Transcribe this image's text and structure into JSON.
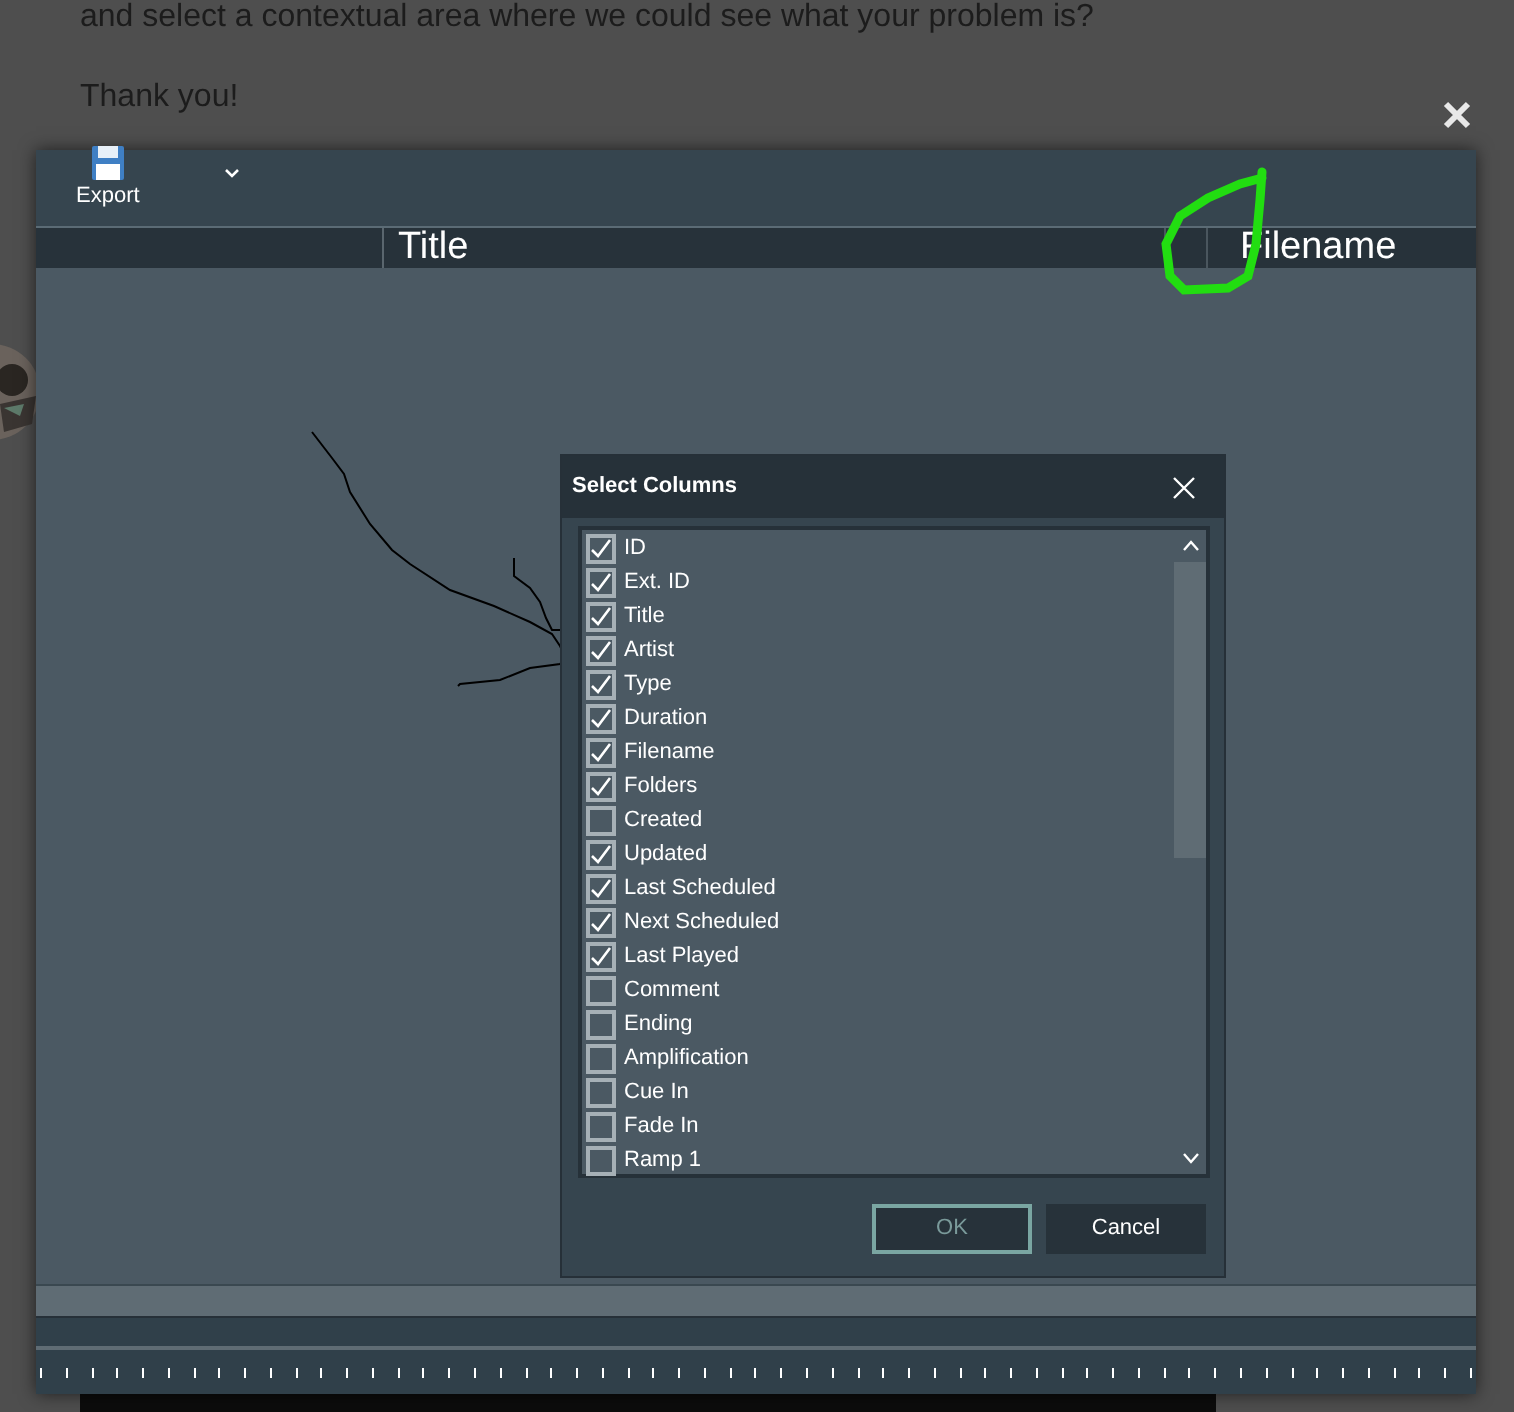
{
  "page": {
    "paragraphs": [
      "and select a contextual area where we could see what your problem is?",
      "Thank you!"
    ]
  },
  "toolbar": {
    "export_label": "Export"
  },
  "table": {
    "columns": [
      "Title",
      "Filename"
    ]
  },
  "dialog": {
    "title": "Select Columns",
    "items": [
      {
        "label": "ID",
        "checked": true
      },
      {
        "label": "Ext. ID",
        "checked": true
      },
      {
        "label": "Title",
        "checked": true
      },
      {
        "label": "Artist",
        "checked": true
      },
      {
        "label": "Type",
        "checked": true
      },
      {
        "label": "Duration",
        "checked": true
      },
      {
        "label": "Filename",
        "checked": true
      },
      {
        "label": "Folders",
        "checked": true
      },
      {
        "label": "Created",
        "checked": false
      },
      {
        "label": "Updated",
        "checked": true
      },
      {
        "label": "Last Scheduled",
        "checked": true
      },
      {
        "label": "Next Scheduled",
        "checked": true
      },
      {
        "label": "Last Played",
        "checked": true
      },
      {
        "label": "Comment",
        "checked": false
      },
      {
        "label": "Ending",
        "checked": false
      },
      {
        "label": "Amplification",
        "checked": false
      },
      {
        "label": "Cue In",
        "checked": false
      },
      {
        "label": "Fade In",
        "checked": false
      },
      {
        "label": "Ramp 1",
        "checked": false
      }
    ],
    "buttons": [
      {
        "label": "OK",
        "disabled": true
      },
      {
        "label": "Cancel",
        "disabled": false
      }
    ]
  }
}
